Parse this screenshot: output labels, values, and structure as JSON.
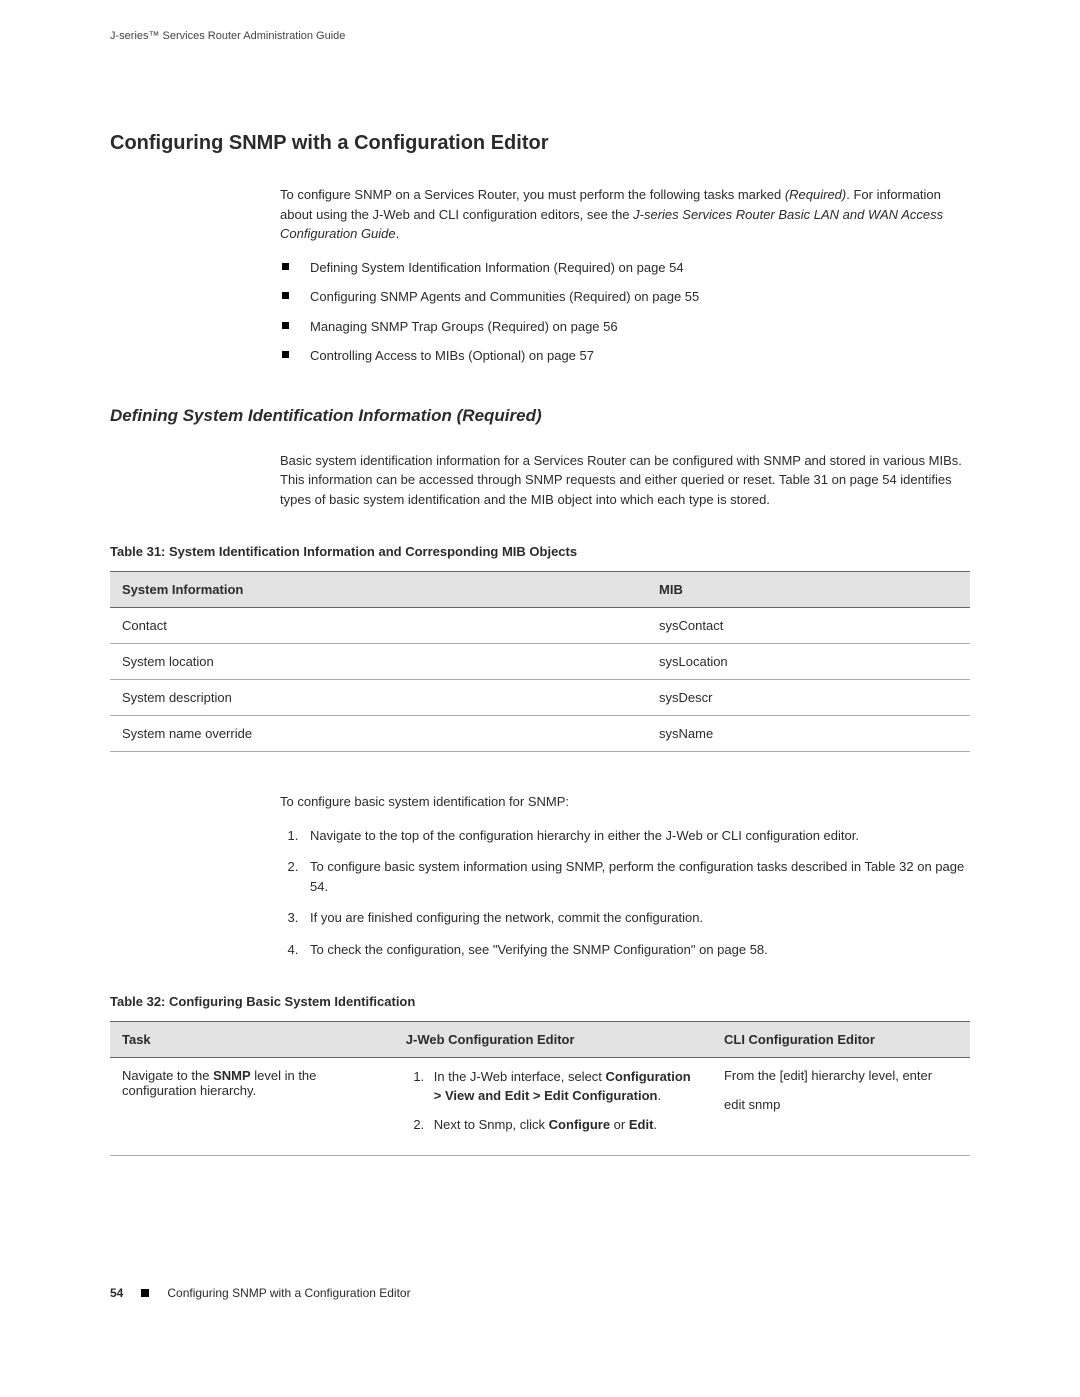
{
  "running_head": "J-series™ Services Router Administration Guide",
  "section_title": "Configuring SNMP with a Configuration Editor",
  "intro_p1_a": "To configure SNMP on a Services Router, you must perform the following tasks marked ",
  "intro_p1_b": "(Required)",
  "intro_p1_c": ". For information about using the J-Web and CLI configuration editors, see the ",
  "intro_p1_d": "J-series Services Router Basic LAN and WAN Access Configuration Guide",
  "intro_p1_e": ".",
  "bullets": [
    "Defining System Identification Information (Required) on page 54",
    "Configuring SNMP Agents and Communities (Required) on page 55",
    "Managing SNMP Trap Groups (Required) on page 56",
    "Controlling Access to MIBs (Optional) on page 57"
  ],
  "subsection_title": "Defining System Identification Information (Required)",
  "sub_p1": "Basic system identification information for a Services Router can be configured with SNMP and stored in various MIBs. This information can be accessed through SNMP requests and either queried or reset. Table 31 on page 54 identifies types of basic system identification and the MIB object into which each type is stored.",
  "table31_caption": "Table 31: System Identification Information and Corresponding MIB Objects",
  "table31": {
    "headers": [
      "System Information",
      "MIB"
    ],
    "rows": [
      [
        "Contact",
        "sysContact"
      ],
      [
        "System location",
        "sysLocation"
      ],
      [
        "System description",
        "sysDescr"
      ],
      [
        "System name override",
        "sysName"
      ]
    ]
  },
  "sub_p2": "To configure basic system identification for SNMP:",
  "steps": [
    "Navigate to the top of the configuration hierarchy in either the J-Web or CLI configuration editor.",
    "To configure basic system information using SNMP, perform the configuration tasks described in Table 32 on page 54.",
    "If you are finished configuring the network, commit the configuration.",
    "To check the configuration, see \"Verifying the SNMP Configuration\" on page 58."
  ],
  "table32_caption": "Table 32: Configuring Basic System Identification",
  "table32": {
    "headers": [
      "Task",
      "J-Web Configuration Editor",
      "CLI Configuration Editor"
    ],
    "row1": {
      "task_a": "Navigate to the ",
      "task_b": "SNMP",
      "task_c": " level in the configuration hierarchy.",
      "jweb1_a": "In the J-Web interface, select ",
      "jweb1_b": "Configuration > View and Edit > Edit Configuration",
      "jweb1_c": ".",
      "jweb2_a": "Next to Snmp, click ",
      "jweb2_b": "Configure",
      "jweb2_c": " or ",
      "jweb2_d": "Edit",
      "jweb2_e": ".",
      "cli_a": "From the ",
      "cli_b": "[edit]",
      "cli_c": " hierarchy level, enter",
      "cli_cmd": "edit snmp"
    }
  },
  "footer": {
    "page": "54",
    "text": "Configuring SNMP with a Configuration Editor"
  }
}
